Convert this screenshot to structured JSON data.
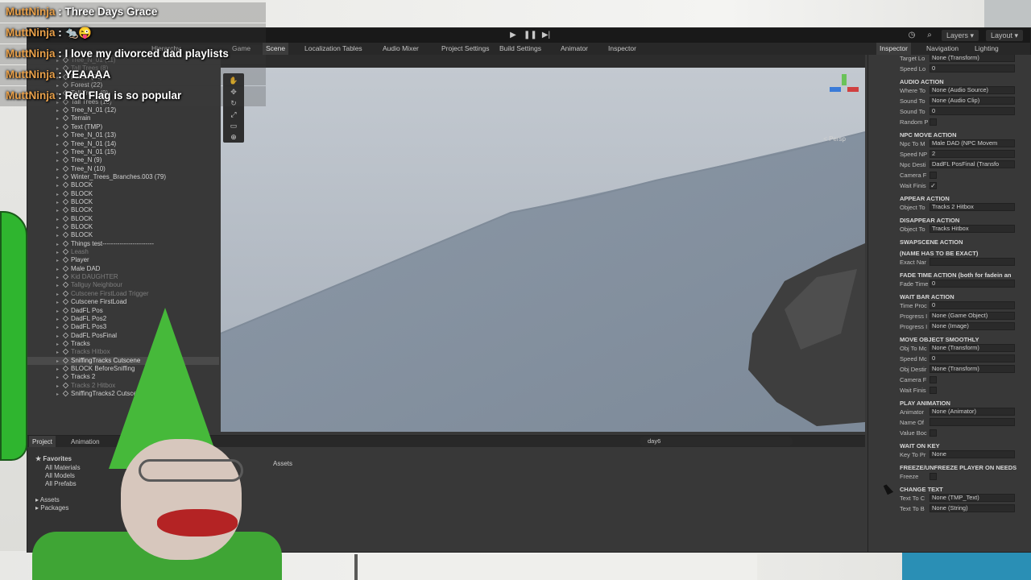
{
  "chat": [
    {
      "user": "MuttNinja",
      "text": ": Three Days Grace"
    },
    {
      "user": "MuttNinja",
      "text": ": 🐀😜"
    },
    {
      "user": "MuttNinja",
      "text": ": I love my divorced dad playlists"
    },
    {
      "user": "MuttNinja",
      "text": ": YEAAAA"
    },
    {
      "user": "MuttNinja",
      "text": ": Red Flag is so popular"
    }
  ],
  "toolbar": {
    "layers": "Layers",
    "layout": "Layout"
  },
  "tabs": [
    "Game",
    "Scene",
    "Localization Tables",
    "Audio Mixer",
    "Project Settings",
    "Build Settings",
    "Animator",
    "Inspector"
  ],
  "right_tabs": [
    "Inspector",
    "Navigation",
    "Lighting"
  ],
  "hierarchy_title": "Hierarchy",
  "hierarchy": [
    {
      "label": "Tree_N_01 (11)",
      "dim": true
    },
    {
      "label": "Tall Trees (8)",
      "dim": true
    },
    {
      "label": "Forest (21)",
      "dim": false
    },
    {
      "label": "Forest (22)",
      "dim": false
    },
    {
      "label": "Tall Trees (9)",
      "dim": false
    },
    {
      "label": "Tall Trees (10)",
      "dim": false
    },
    {
      "label": "Tree_N_01 (12)",
      "dim": false
    },
    {
      "label": "Terrain",
      "dim": false
    },
    {
      "label": "Text (TMP)",
      "dim": false
    },
    {
      "label": "Tree_N_01 (13)",
      "dim": false
    },
    {
      "label": "Tree_N_01 (14)",
      "dim": false
    },
    {
      "label": "Tree_N_01 (15)",
      "dim": false
    },
    {
      "label": "Tree_N (9)",
      "dim": false
    },
    {
      "label": "Tree_N (10)",
      "dim": false
    },
    {
      "label": "Winter_Trees_Branches.003 (79)",
      "dim": false
    },
    {
      "label": "BLOCK",
      "dim": false
    },
    {
      "label": "BLOCK",
      "dim": false
    },
    {
      "label": "BLOCK",
      "dim": false
    },
    {
      "label": "BLOCK",
      "dim": false
    },
    {
      "label": "BLOCK",
      "dim": false
    },
    {
      "label": "BLOCK",
      "dim": false
    },
    {
      "label": "BLOCK",
      "dim": false
    },
    {
      "label": "Things test------------------------",
      "dim": false
    },
    {
      "label": "Leash",
      "dim": true
    },
    {
      "label": "Player",
      "dim": false
    },
    {
      "label": "Male DAD",
      "dim": false
    },
    {
      "label": "Kid DAUGHTER",
      "dim": true
    },
    {
      "label": "Tallguy Neighbour",
      "dim": true
    },
    {
      "label": "Cutscene FirstLoad Trigger",
      "dim": true
    },
    {
      "label": "Cutscene FirstLoad",
      "dim": false
    },
    {
      "label": "DadFL Pos",
      "dim": false
    },
    {
      "label": "DadFL Pos2",
      "dim": false
    },
    {
      "label": "DadFL Pos3",
      "dim": false
    },
    {
      "label": "DadFL PosFinal",
      "dim": false
    },
    {
      "label": "Tracks",
      "dim": false
    },
    {
      "label": "Tracks Hitbox",
      "dim": true
    },
    {
      "label": "SniffingTracks Cutscene",
      "dim": false
    },
    {
      "label": "BLOCK BeforeSniffing",
      "dim": false
    },
    {
      "label": "Tracks 2",
      "dim": false
    },
    {
      "label": "Tracks 2 Hitbox",
      "dim": true
    },
    {
      "label": "SniffingTracks2 Cutscene",
      "dim": false
    }
  ],
  "bottom": {
    "tabs": [
      "Project",
      "Animation"
    ],
    "search": "day6",
    "breadcrumb": "Assets",
    "favorites": "Favorites",
    "fav_items": [
      "All Materials",
      "All Models",
      "All Prefabs"
    ],
    "assets": "Assets",
    "packages": "Packages"
  },
  "inspector": {
    "top_field": "None (Transform)",
    "rows": [
      {
        "type": "label",
        "label": "Target Lo",
        "value": "None (Transform)"
      },
      {
        "type": "label",
        "label": "Speed Lo",
        "value": "0"
      },
      {
        "type": "section",
        "label": "AUDIO ACTION"
      },
      {
        "type": "label",
        "label": "Where To",
        "value": "None (Audio Source)"
      },
      {
        "type": "label",
        "label": "Sound To",
        "value": "None (Audio Clip)"
      },
      {
        "type": "label",
        "label": "Sound To",
        "value": "0"
      },
      {
        "type": "check",
        "label": "Random P",
        "value": ""
      },
      {
        "type": "section",
        "label": "NPC MOVE ACTION"
      },
      {
        "type": "label",
        "label": "Npc To M",
        "value": "Male DAD (NPC Movem"
      },
      {
        "type": "label",
        "label": "Speed NP",
        "value": "2"
      },
      {
        "type": "label",
        "label": "Npc Desti",
        "value": "DadFL PosFinal (Transfo"
      },
      {
        "type": "check",
        "label": "Camera F",
        "value": ""
      },
      {
        "type": "check",
        "label": "Wait Finis",
        "value": "✓"
      },
      {
        "type": "section",
        "label": "APPEAR ACTION"
      },
      {
        "type": "label",
        "label": "Object To",
        "value": "Tracks 2 Hitbox"
      },
      {
        "type": "section",
        "label": "DISAPPEAR ACTION"
      },
      {
        "type": "label",
        "label": "Object To",
        "value": "Tracks Hitbox"
      },
      {
        "type": "section",
        "label": "SWAPSCENE ACTION"
      },
      {
        "type": "section",
        "label": "(NAME HAS TO BE EXACT)"
      },
      {
        "type": "label",
        "label": "Exact Nar",
        "value": ""
      },
      {
        "type": "section",
        "label": "FADE TIME ACTION (both for fadein an"
      },
      {
        "type": "label",
        "label": "Fade Time",
        "value": "0"
      },
      {
        "type": "section",
        "label": "WAIT BAR ACTION"
      },
      {
        "type": "label",
        "label": "Time Proc",
        "value": "0"
      },
      {
        "type": "label",
        "label": "Progress I",
        "value": "None (Game Object)"
      },
      {
        "type": "label",
        "label": "Progress I",
        "value": "None (Image)"
      },
      {
        "type": "section",
        "label": "MOVE OBJECT SMOOTHLY"
      },
      {
        "type": "label",
        "label": "Obj To Mc",
        "value": "None (Transform)"
      },
      {
        "type": "label",
        "label": "Speed Mc",
        "value": "0"
      },
      {
        "type": "label",
        "label": "Obj Destir",
        "value": "None (Transform)"
      },
      {
        "type": "check",
        "label": "Camera F",
        "value": ""
      },
      {
        "type": "check",
        "label": "Wait Finis",
        "value": ""
      },
      {
        "type": "section",
        "label": "PLAY ANIMATION"
      },
      {
        "type": "label",
        "label": "Animator",
        "value": "None (Animator)"
      },
      {
        "type": "label",
        "label": "Name Of",
        "value": ""
      },
      {
        "type": "check",
        "label": "Value Boc",
        "value": ""
      },
      {
        "type": "section",
        "label": "WAIT ON KEY"
      },
      {
        "type": "label",
        "label": "Key To Pr",
        "value": "None"
      },
      {
        "type": "section",
        "label": "FREEZE/UNFREEZE PLAYER ON NEEDS"
      },
      {
        "type": "check",
        "label": "Freeze",
        "value": ""
      },
      {
        "type": "section",
        "label": "CHANGE TEXT"
      },
      {
        "type": "label",
        "label": "Text To C",
        "value": "None (TMP_Text)"
      },
      {
        "type": "label",
        "label": "Text To B",
        "value": "None (String)"
      }
    ]
  },
  "scene_view": {
    "persp": "< Persp"
  }
}
